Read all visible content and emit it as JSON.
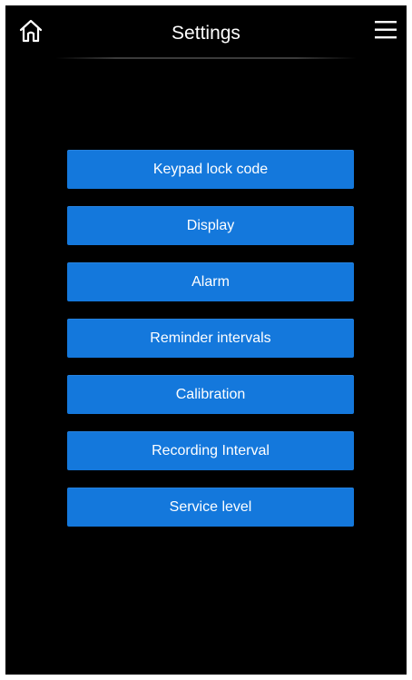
{
  "header": {
    "title": "Settings",
    "home_icon": "home-icon",
    "menu_icon": "hamburger-menu-icon"
  },
  "colors": {
    "background": "#000000",
    "button": "#1478dc",
    "text": "#ffffff"
  },
  "menu": {
    "items": [
      {
        "label": "Keypad lock code"
      },
      {
        "label": "Display"
      },
      {
        "label": "Alarm"
      },
      {
        "label": "Reminder intervals"
      },
      {
        "label": "Calibration"
      },
      {
        "label": "Recording Interval"
      },
      {
        "label": "Service level"
      }
    ]
  }
}
